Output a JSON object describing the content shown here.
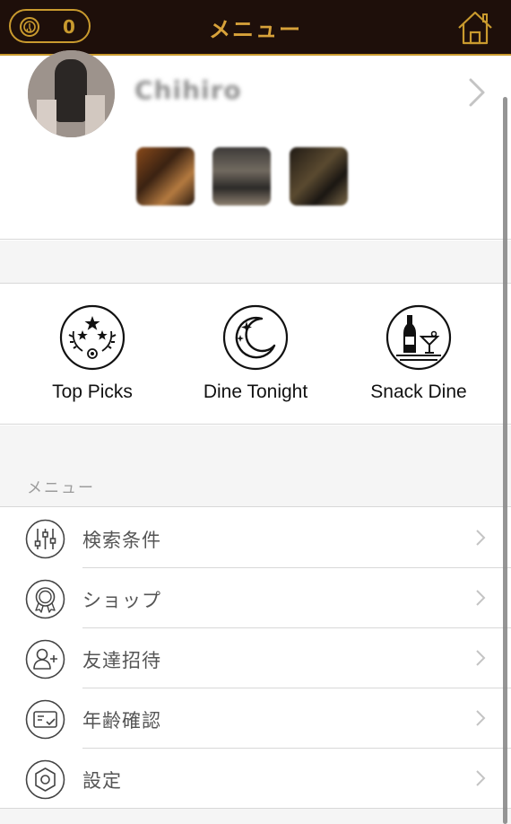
{
  "header": {
    "coin_count": "0",
    "title": "メニュー",
    "home_icon": "home-icon",
    "coin_icon": "coin-icon"
  },
  "profile": {
    "name": "Chihiro",
    "chevron_icon": "chevron-right-icon",
    "photos": [
      "photo-1",
      "photo-2",
      "photo-3"
    ]
  },
  "categories": [
    {
      "label": "Top Picks",
      "icon": "laurel-stars-icon"
    },
    {
      "label": "Dine Tonight",
      "icon": "moon-stars-icon"
    },
    {
      "label": "Snack Dine",
      "icon": "bottle-cocktail-icon"
    }
  ],
  "menu": {
    "section_label": "メニュー",
    "items": [
      {
        "label": "検索条件",
        "icon": "sliders-icon"
      },
      {
        "label": "ショップ",
        "icon": "badge-icon"
      },
      {
        "label": "友達招待",
        "icon": "add-friend-icon"
      },
      {
        "label": "年齢確認",
        "icon": "id-check-icon"
      },
      {
        "label": "設定",
        "icon": "hexagon-settings-icon"
      }
    ]
  },
  "colors": {
    "header_bg": "#1e0f0a",
    "accent_gold": "#c99a2e",
    "divider": "#d8d8d8",
    "section_bg": "#f5f5f5"
  }
}
